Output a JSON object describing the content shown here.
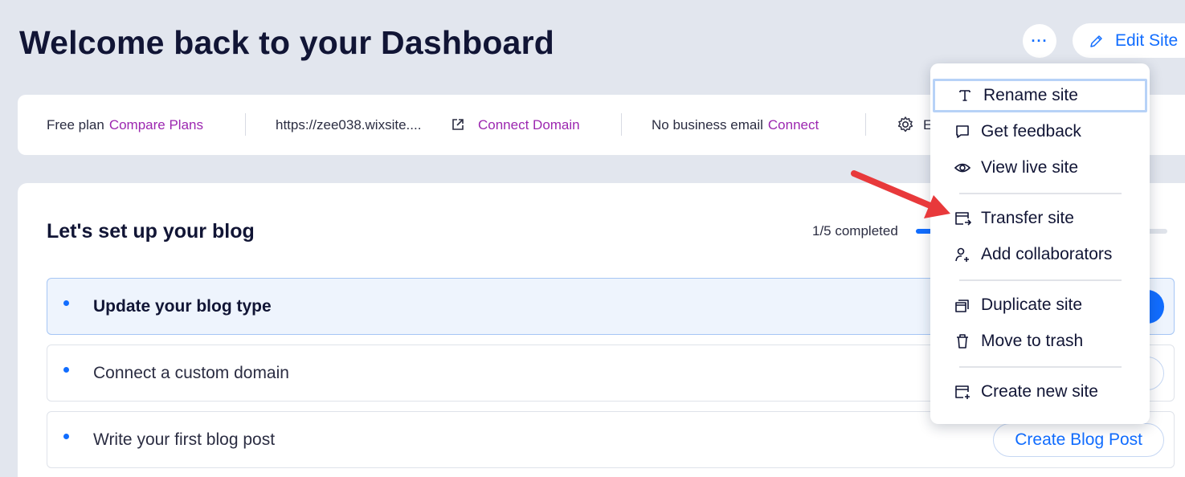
{
  "header": {
    "title": "Welcome back to your Dashboard",
    "more_label": "···",
    "edit_site_label": "Edit Site"
  },
  "info_bar": {
    "plan_text": "Free plan",
    "compare_plans": "Compare Plans",
    "site_url": "https://zee038.wixsite....",
    "connect_domain": "Connect Domain",
    "email_text": "No business email",
    "connect": "Connect",
    "truncated_item": "E"
  },
  "setup": {
    "title": "Let's set up your blog",
    "progress_text": "1/5 completed",
    "progress_fraction": 0.2,
    "tasks": [
      {
        "label": "Update your blog type",
        "active": true
      },
      {
        "label": "Connect a custom domain",
        "active": false
      },
      {
        "label": "Write your first blog post",
        "active": false,
        "button": "Create Blog Post"
      }
    ]
  },
  "menu": {
    "items": [
      {
        "label": "Rename site",
        "icon": "text-t-icon"
      },
      {
        "label": "Get feedback",
        "icon": "chat-bubble-icon"
      },
      {
        "label": "View live site",
        "icon": "eye-icon"
      },
      {
        "label": "Transfer site",
        "icon": "transfer-icon"
      },
      {
        "label": "Add collaborators",
        "icon": "add-person-icon"
      },
      {
        "label": "Duplicate site",
        "icon": "duplicate-icon"
      },
      {
        "label": "Move to trash",
        "icon": "trash-icon"
      },
      {
        "label": "Create new site",
        "icon": "new-site-icon"
      }
    ]
  },
  "colors": {
    "accent": "#116dff",
    "link_purple": "#9c27b0",
    "arrow_red": "#e8393b",
    "background": "#e2e6ee"
  }
}
